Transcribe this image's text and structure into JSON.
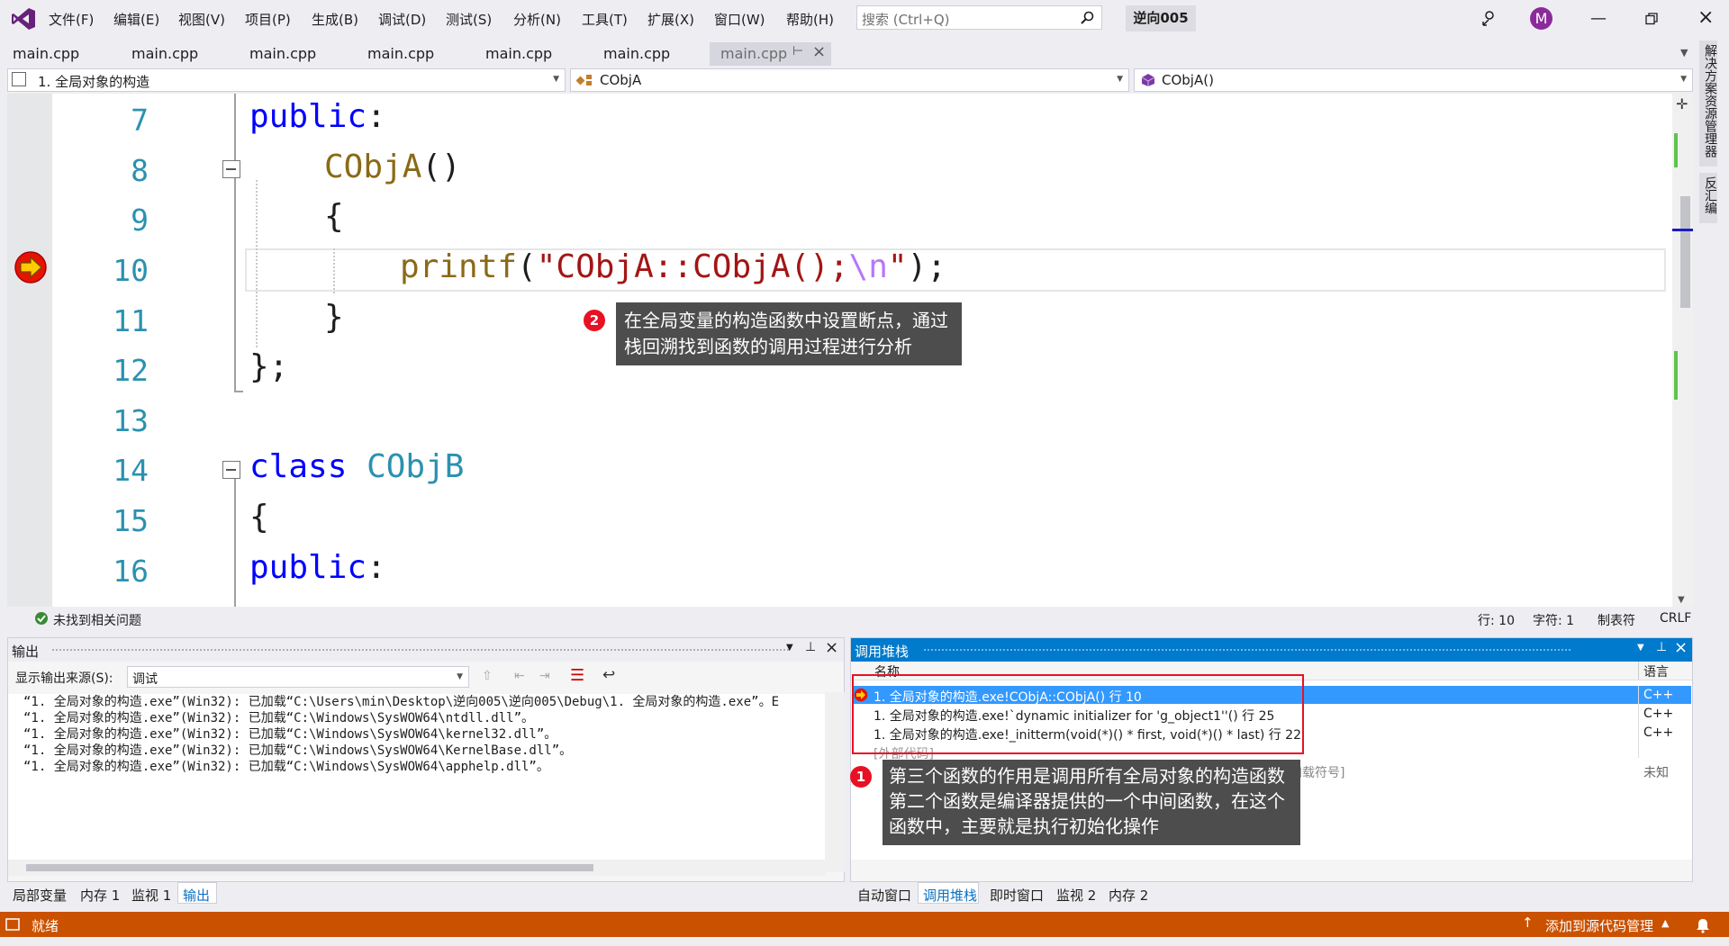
{
  "menubar": {
    "items": [
      "文件(F)",
      "编辑(E)",
      "视图(V)",
      "项目(P)",
      "生成(B)",
      "调试(D)",
      "测试(S)",
      "分析(N)",
      "工具(T)",
      "扩展(X)",
      "窗口(W)",
      "帮助(H)"
    ],
    "search_placeholder": "搜索 (Ctrl+Q)",
    "solution_name": "逆向005",
    "avatar_letter": "M"
  },
  "tabs": [
    "main.cpp",
    "main.cpp",
    "main.cpp",
    "main.cpp",
    "main.cpp",
    "main.cpp",
    "main.cpp"
  ],
  "navbar": {
    "project": "1. 全局对象的构造",
    "class": "CObjA",
    "member": "CObjA()"
  },
  "editor": {
    "line_numbers": [
      "7",
      "8",
      "9",
      "10",
      "11",
      "12",
      "13",
      "14",
      "15",
      "16"
    ],
    "current_line": "10"
  },
  "sidebar_vertical": {
    "solution_explorer": "解决方案资源管理器",
    "disassembly": "反汇编"
  },
  "callouts": {
    "c2_badge": "2",
    "c2_line1": "在全局变量的构造函数中设置断点，通过",
    "c2_line2": "栈回溯找到函数的调用过程进行分析",
    "c1_badge": "1",
    "c1_line1": "第三个函数的作用是调用所有全局对象的构造函数",
    "c1_line2": "第二个函数是编译器提供的一个中间函数，在这个",
    "c1_line3": "函数中，主要就是执行初始化操作"
  },
  "editor_status": {
    "issues": "未找到相关问题",
    "line": "行: 10",
    "col": "字符: 1",
    "tabs": "制表符",
    "eol": "CRLF"
  },
  "output_panel": {
    "title": "输出",
    "source_label": "显示输出来源(S):",
    "source_value": "调试",
    "lines": [
      "“1. 全局对象的构造.exe”(Win32): 已加载“C:\\Users\\min\\Desktop\\逆向005\\逆向005\\Debug\\1. 全局对象的构造.exe”。E",
      "“1. 全局对象的构造.exe”(Win32): 已加载“C:\\Windows\\SysWOW64\\ntdll.dll”。",
      "“1. 全局对象的构造.exe”(Win32): 已加载“C:\\Windows\\SysWOW64\\kernel32.dll”。",
      "“1. 全局对象的构造.exe”(Win32): 已加载“C:\\Windows\\SysWOW64\\KernelBase.dll”。",
      "“1. 全局对象的构造.exe”(Win32): 已加载“C:\\Windows\\SysWOW64\\apphelp.dll”。"
    ]
  },
  "callstack_panel": {
    "title": "调用堆栈",
    "col_name": "名称",
    "col_lang": "语言",
    "rows": [
      {
        "name": "1. 全局对象的构造.exe!CObjA::CObjA() 行 10",
        "lang": "C++"
      },
      {
        "name": "1. 全局对象的构造.exe!`dynamic initializer for 'g_object1''() 行 25",
        "lang": "C++"
      },
      {
        "name": "1. 全局对象的构造.exe!_initterm(void(*)() * first, void(*)() * last) 行 22",
        "lang": "C++"
      },
      {
        "name": "[外部代码]",
        "lang": ""
      },
      {
        "name": "加载符号]",
        "lang": "未知"
      }
    ]
  },
  "bottom_tabs_left": [
    "局部变量",
    "内存 1",
    "监视 1",
    "输出"
  ],
  "bottom_tabs_right": [
    "自动窗口",
    "调用堆栈",
    "即时窗口",
    "监视 2",
    "内存 2"
  ],
  "statusbar": {
    "ready": "就绪",
    "source_control": "添加到源代码管理"
  },
  "colors": {
    "accent": "#007acc",
    "status_bar": "#ca5100",
    "selection": "#3399ff",
    "callout_border": "#e81123"
  }
}
